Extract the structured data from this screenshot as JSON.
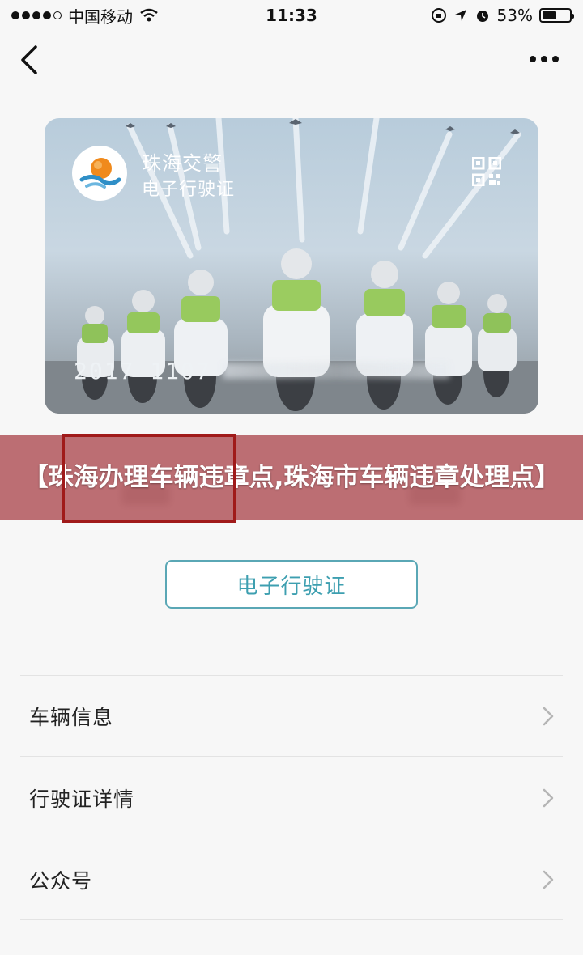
{
  "status_bar": {
    "carrier": "中国移动",
    "time": "11:33",
    "battery": "53%",
    "battery_level": 0.53,
    "icons": [
      "signal-dots-icon",
      "wifi-icon",
      "lock-rotation-icon",
      "location-icon",
      "alarm-icon",
      "battery-icon"
    ]
  },
  "nav": {
    "back_icon": "chevron-left-icon",
    "more_icon": "more-dots-icon"
  },
  "card": {
    "title": "珠海交警",
    "subtitle": "电子行驶证",
    "number": "2017 1107",
    "logo_icon": "zhuhai-police-logo",
    "qr_icon": "qr-code-icon"
  },
  "banner": {
    "text": "【珠海办理车辆违章点,珠海市车辆违章处理点】"
  },
  "button": {
    "label": "电子行驶证"
  },
  "menu": {
    "items": [
      {
        "label": "车辆信息"
      },
      {
        "label": "行驶证详情"
      },
      {
        "label": "公众号"
      }
    ]
  },
  "colors": {
    "accent": "#3d9fb0",
    "banner": "#ac484e",
    "frame": "#a01a1a"
  }
}
